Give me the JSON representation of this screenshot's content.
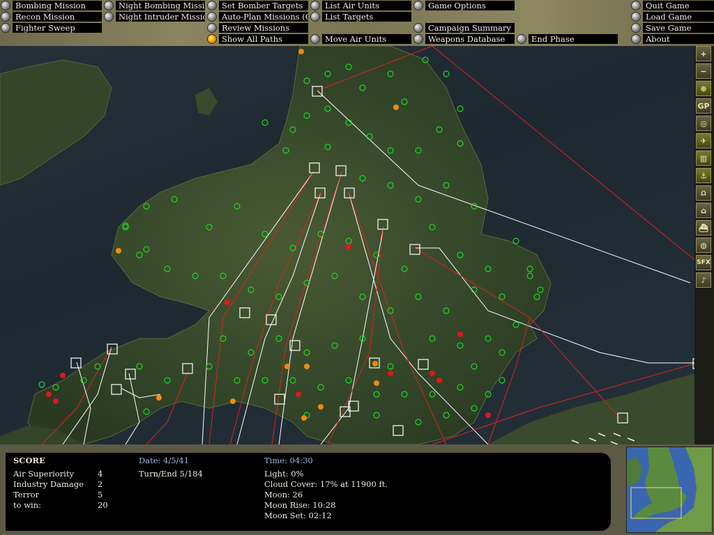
{
  "toolbar": {
    "bombing_mission": "Bombing Mission",
    "recon_mission": "Recon Mission",
    "fighter_sweep": "Fighter Sweep",
    "night_bombing_mission": "Night Bombing Mission",
    "night_intruder_mission": "Night Intruder Mission",
    "set_bomber_targets": "Set Bomber Targets",
    "auto_plan_missions": "Auto-Plan Missions (Off)",
    "review_missions": "Review Missions",
    "show_all_paths": "Show All Paths",
    "list_air_units": "List Air Units",
    "list_targets": "List Targets",
    "move_air_units": "Move Air Units",
    "game_options": "Game Options",
    "campaign_summary": "Campaign Summary",
    "weapons_database": "Weapons Database",
    "end_phase": "End Phase",
    "quit_game": "Quit Game",
    "load_game": "Load Game",
    "save_game": "Save Game",
    "about": "About"
  },
  "side_tools": [
    {
      "icon": "zoom-in-icon",
      "glyph": "+"
    },
    {
      "icon": "zoom-out-icon",
      "glyph": "−"
    },
    {
      "icon": "crosshair-icon",
      "glyph": "⊕"
    },
    {
      "icon": "gp-icon",
      "glyph": "GP"
    },
    {
      "icon": "target-icon",
      "glyph": "◎"
    },
    {
      "icon": "aircraft-icon",
      "glyph": "✈"
    },
    {
      "icon": "factory-icon",
      "glyph": "▥"
    },
    {
      "icon": "anchor-icon",
      "glyph": "⚓"
    },
    {
      "icon": "bridge-icon",
      "glyph": "⩍"
    },
    {
      "icon": "building-icon",
      "glyph": "⌂"
    },
    {
      "icon": "ship-icon",
      "glyph": "⛴"
    },
    {
      "icon": "radar-icon",
      "glyph": "◍"
    },
    {
      "icon": "sfx-icon",
      "glyph": "SFX"
    },
    {
      "icon": "music-icon",
      "glyph": "♪"
    }
  ],
  "score": {
    "heading": "SCORE",
    "rows": [
      {
        "label": "Air Superiority",
        "value": "4"
      },
      {
        "label": "Industry Damage",
        "value": "2"
      },
      {
        "label": "Terror",
        "value": "5"
      },
      {
        "label": "to win:",
        "value": "20"
      }
    ]
  },
  "status": {
    "date": "Date: 4/5/41",
    "turn": "Turn/End  5/184",
    "time": "Time: 04:30",
    "light": "Light: 0%",
    "cloud": "Cloud Cover: 17% at 11900 ft.",
    "moon": "Moon: 26",
    "moon_rise": "Moon Rise: 10:28",
    "moon_set": "Moon Set: 02:12"
  },
  "colors": {
    "land_green": "#2f4a28",
    "sea": "#1f2a32",
    "friendly_marker": "#22d622",
    "enemy_marker": "#e01818",
    "damaged_marker": "#f08a10",
    "path_white": "#ffffff",
    "path_red": "#e02020"
  }
}
